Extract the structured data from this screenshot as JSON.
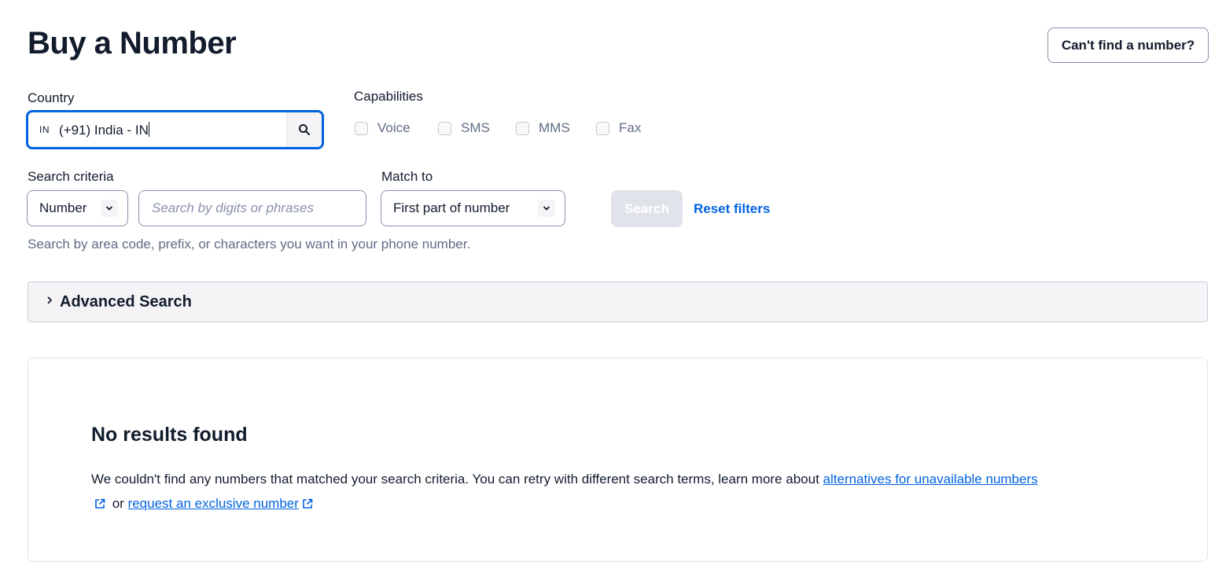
{
  "page": {
    "title": "Buy a Number",
    "cant_find_label": "Can't find a number?"
  },
  "country": {
    "label": "Country",
    "code": "IN",
    "value": "(+91) India - IN"
  },
  "capabilities": {
    "label": "Capabilities",
    "items": [
      {
        "label": "Voice",
        "checked": false
      },
      {
        "label": "SMS",
        "checked": false
      },
      {
        "label": "MMS",
        "checked": false
      },
      {
        "label": "Fax",
        "checked": false
      }
    ]
  },
  "search_criteria": {
    "label": "Search criteria",
    "selected": "Number",
    "placeholder": "Search by digits or phrases",
    "help": "Search by area code, prefix, or characters you want in your phone number."
  },
  "match_to": {
    "label": "Match to",
    "selected": "First part of number"
  },
  "actions": {
    "search_label": "Search",
    "reset_label": "Reset filters"
  },
  "advanced": {
    "label": "Advanced Search"
  },
  "results": {
    "title": "No results found",
    "body_prefix": "We couldn't find any numbers that matched your search criteria. You can retry with different search terms, learn more about ",
    "link1": "alternatives for unavailable numbers",
    "connector": " or ",
    "link2": "request an exclusive number"
  },
  "colors": {
    "accent": "#0263e0",
    "text": "#121c2d",
    "muted": "#606b85"
  }
}
